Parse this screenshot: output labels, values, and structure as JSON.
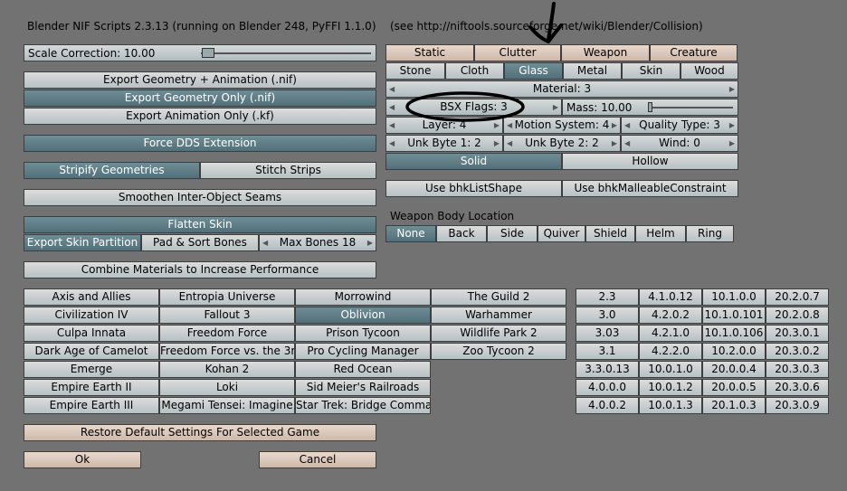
{
  "header": {
    "title": "Blender NIF Scripts 2.3.13 (running on Blender 248, PyFFI 1.1.0)",
    "url_note": "(see http://niftools.sourceforge.net/wiki/Blender/Collision)"
  },
  "left": {
    "scale_correction": "Scale Correction:  10.00",
    "export_geom_anim": "Export Geometry + Animation (.nif)",
    "export_geom_only": "Export Geometry Only (.nif)",
    "export_anim_only": "Export Animation Only (.kf)",
    "force_dds": "Force DDS Extension",
    "stripify": "Stripify Geometries",
    "stitch_strips": "Stitch Strips",
    "smoothen_seams": "Smoothen Inter-Object Seams",
    "flatten_skin": "Flatten Skin",
    "export_skin_partition": "Export Skin Partition",
    "pad_sort_bones": "Pad & Sort Bones",
    "max_bones": "Max Bones 18",
    "combine_materials": "Combine Materials to Increase Performance"
  },
  "collision": {
    "types": [
      "Static",
      "Clutter",
      "Weapon",
      "Creature"
    ],
    "materials": [
      "Stone",
      "Cloth",
      "Glass",
      "Metal",
      "Skin",
      "Wood"
    ],
    "material": "Material:  3",
    "bsx_flags": "BSX Flags:  3",
    "mass": "Mass:  10.00",
    "layer": "Layer:  4",
    "motion_system": "Motion System:  4",
    "quality_type": "Quality Type:  3",
    "unk_byte1": "Unk Byte 1:  2",
    "unk_byte2": "Unk Byte 2:  2",
    "wind": "Wind:  0",
    "solid": "Solid",
    "hollow": "Hollow",
    "use_list_shape": "Use bhkListShape",
    "use_malleable": "Use bhkMalleableConstraint"
  },
  "weapon": {
    "label": "Weapon Body Location",
    "locations": [
      "None",
      "Back",
      "Side",
      "Quiver",
      "Shield",
      "Helm",
      "Ring"
    ]
  },
  "games": {
    "col1": [
      "Axis and Allies",
      "Civilization IV",
      "Culpa Innata",
      "Dark Age of Camelot",
      "Emerge",
      "Empire Earth II",
      "Empire Earth III"
    ],
    "col2": [
      "Entropia Universe",
      "Fallout 3",
      "Freedom Force",
      "Freedom Force vs. the 3r",
      "Kohan 2",
      "Loki",
      "Megami Tensei: Imagine"
    ],
    "col3": [
      "Morrowind",
      "Oblivion",
      "Prison Tycoon",
      "Pro Cycling Manager",
      "Red Ocean",
      "Sid Meier's Railroads",
      "Star Trek: Bridge Comman"
    ],
    "col4": [
      "The Guild 2",
      "Warhammer",
      "Wildlife Park 2",
      "Zoo Tycoon 2"
    ]
  },
  "versions": {
    "col1": [
      "2.3",
      "3.0",
      "3.03",
      "3.1",
      "3.3.0.13",
      "4.0.0.0",
      "4.0.0.2"
    ],
    "col2": [
      "4.1.0.12",
      "4.2.0.2",
      "4.2.1.0",
      "4.2.2.0",
      "10.0.1.0",
      "10.0.1.2",
      "10.0.1.3"
    ],
    "col3": [
      "10.1.0.0",
      "10.1.0.101",
      "10.1.0.106",
      "10.2.0.0",
      "20.0.0.4",
      "20.0.0.5",
      "20.1.0.3"
    ],
    "col4": [
      "20.2.0.7",
      "20.2.0.8",
      "20.3.0.1",
      "20.3.0.2",
      "20.3.0.3",
      "20.3.0.6",
      "20.3.0.9"
    ]
  },
  "footer": {
    "restore": "Restore Default Settings For Selected Game",
    "ok": "Ok",
    "cancel": "Cancel"
  }
}
